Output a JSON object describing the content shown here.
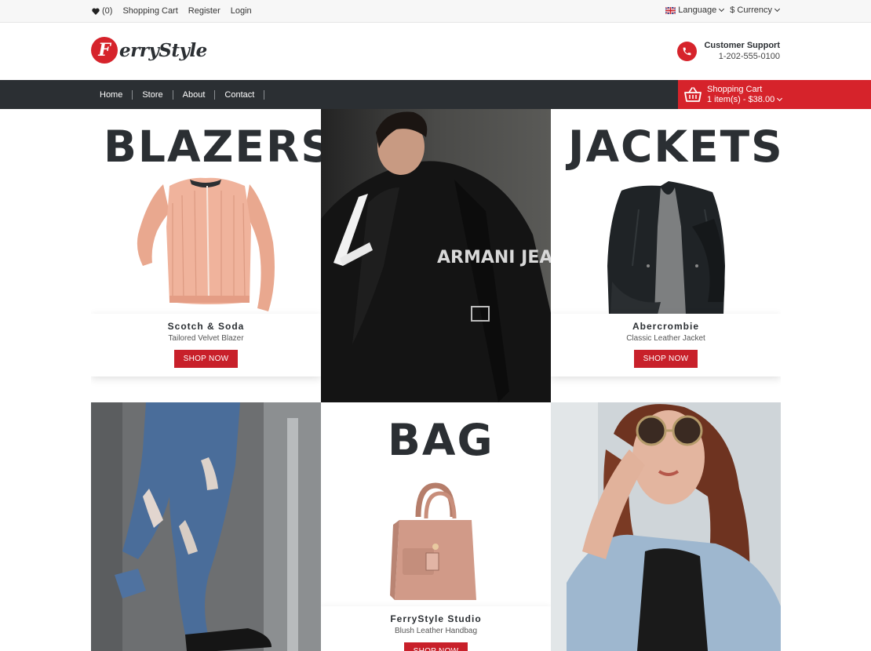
{
  "topbar": {
    "wishlist_count": "(0)",
    "links": [
      "Shopping Cart",
      "Register",
      "Login"
    ],
    "language": "Language",
    "currency": "$ Currency"
  },
  "header": {
    "logo_letter": "F",
    "logo_text": "erryStyle",
    "support_title": "Customer Support",
    "support_phone": "1-202-555-0100"
  },
  "nav": {
    "items": [
      "Home",
      "Store",
      "About",
      "Contact"
    ],
    "cart_title": "Shopping Cart",
    "cart_summary": "1 item(s) - $38.00"
  },
  "tiles": {
    "blazers": {
      "title": "BLAZERS",
      "brand": "Scotch & Soda",
      "desc": "Tailored Velvet Blazer",
      "button": "SHOP NOW"
    },
    "jackets": {
      "title": "JACKETS",
      "brand": "Abercrombie",
      "desc": "Classic Leather Jacket",
      "button": "SHOP NOW"
    },
    "bag": {
      "title": "BAG",
      "brand": "FerryStyle Studio",
      "desc": "Blush Leather Handbag",
      "button": "SHOP NOW"
    },
    "model1_print": "ARMANI JEANS"
  },
  "colors": {
    "accent": "#d6232b",
    "dark": "#2b2f33"
  },
  "icons": [
    "heart-icon",
    "uk-flag-icon",
    "chevron-down-icon",
    "phone-icon",
    "cart-icon"
  ]
}
